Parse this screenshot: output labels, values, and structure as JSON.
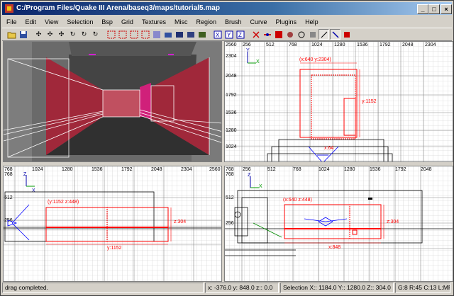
{
  "window": {
    "title": "C:/Program Files/Quake III Arena/baseq3/maps/tutorial5.map",
    "min_label": "_",
    "max_label": "□",
    "close_label": "×"
  },
  "menu": [
    "File",
    "Edit",
    "View",
    "Selection",
    "Bsp",
    "Grid",
    "Textures",
    "Misc",
    "Region",
    "Brush",
    "Curve",
    "Plugins",
    "Help"
  ],
  "toolbar_icons": [
    "open-icon",
    "save-icon",
    "flip-x-icon",
    "flip-y-icon",
    "flip-z-icon",
    "rotate-x-icon",
    "rotate-y-icon",
    "rotate-z-icon",
    "select-complete-tall-icon",
    "select-touching-icon",
    "select-partial-tall-icon",
    "select-inside-icon",
    "csg-subtract-icon",
    "csg-merge-icon",
    "hollow-icon",
    "change-view-icon",
    "texture-view-icon",
    "view-x-icon",
    "view-y-icon",
    "view-z-icon",
    "clipper-icon",
    "drag-edges-icon",
    "drag-vertices-icon",
    "camera-icon",
    "patch-icon",
    "cubic-clip-icon",
    "scale-lock-icon",
    "select-icon",
    "entity-icon"
  ],
  "xy_top": {
    "axis_top": [
      "2560",
      "256",
      "512",
      "768",
      "1024",
      "1280",
      "1536",
      "1792",
      "2048",
      "2304"
    ],
    "axis_left": [
      "2304",
      "2048",
      "1792",
      "1536",
      "1280",
      "1024"
    ],
    "axis_name_h": "X",
    "axis_name_v": "Y",
    "label_pos": "(x:640 y:2304)",
    "label_size": "y:1152",
    "label_bottom": "x:64"
  },
  "xz_front": {
    "axis_top": [
      "768",
      "1024",
      "1280",
      "1536",
      "1792",
      "2048",
      "2304",
      "2560"
    ],
    "axis_left": [
      "768",
      "512",
      "256"
    ],
    "axis_name_h": "X",
    "axis_name_v": "Z",
    "label_pos": "(y:1152 z:448)",
    "label_size": "z:304",
    "label_bottom": "y:1152"
  },
  "yz_side": {
    "axis_top": [
      "768",
      "256",
      "512",
      "768",
      "1024",
      "1280",
      "1536",
      "1792",
      "2048"
    ],
    "axis_left": [
      "768",
      "512",
      "256"
    ],
    "axis_name_h": "X",
    "axis_name_v": "Z",
    "label_pos": "(x:640 z:448)",
    "label_size": "z:304",
    "label_bottom": "x:848"
  },
  "status": {
    "message": "drag completed.",
    "coords": "x: -376.0  y: 848.0  z:: 0.0",
    "selection": "Selection X:: 1184.0  Y:: 1280.0  Z:: 304.0",
    "grid": "G:8 R:45 C:13 L:MR"
  },
  "colors": {
    "selection": "#ff0000",
    "grid_minor": "#c8c8c8",
    "grid_major": "#000000",
    "camera_wall": "#a0283a",
    "camera_pink": "#d0207a"
  }
}
